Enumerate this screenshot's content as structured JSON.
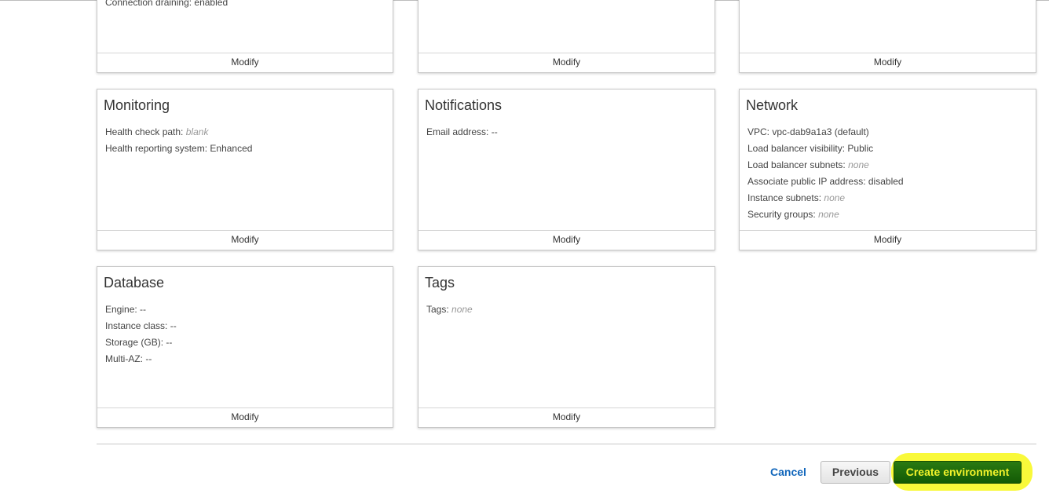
{
  "top_cards": [
    {
      "partial_text": "Connection draining: enabled",
      "footer": "Modify"
    },
    {
      "partial_text": "",
      "footer": "Modify"
    },
    {
      "partial_text": "",
      "footer": "Modify"
    }
  ],
  "cards": {
    "monitoring": {
      "title": "Monitoring",
      "rows": [
        {
          "label": "Health check path:",
          "value": "blank",
          "value_style": "none"
        },
        {
          "label": "Health reporting system:",
          "value": "Enhanced",
          "value_style": "normal"
        }
      ],
      "footer": "Modify"
    },
    "notifications": {
      "title": "Notifications",
      "rows": [
        {
          "label": "Email address:",
          "value": "--",
          "value_style": "normal"
        }
      ],
      "footer": "Modify"
    },
    "network": {
      "title": "Network",
      "rows": [
        {
          "label": "VPC:",
          "value": "vpc-dab9a1a3 (default)",
          "value_style": "normal"
        },
        {
          "label": "Load balancer visibility:",
          "value": "Public",
          "value_style": "normal"
        },
        {
          "label": "Load balancer subnets:",
          "value": "none",
          "value_style": "none"
        },
        {
          "label": "Associate public IP address:",
          "value": "disabled",
          "value_style": "normal"
        },
        {
          "label": "Instance subnets:",
          "value": "none",
          "value_style": "none"
        },
        {
          "label": "Security groups:",
          "value": "none",
          "value_style": "none"
        }
      ],
      "footer": "Modify"
    },
    "database": {
      "title": "Database",
      "rows": [
        {
          "label": "Engine:",
          "value": "--",
          "value_style": "normal"
        },
        {
          "label": "Instance class:",
          "value": "--",
          "value_style": "normal"
        },
        {
          "label": "Storage (GB):",
          "value": "--",
          "value_style": "normal"
        },
        {
          "label": "Multi-AZ:",
          "value": "--",
          "value_style": "normal"
        }
      ],
      "footer": "Modify"
    },
    "tags": {
      "title": "Tags",
      "rows": [
        {
          "label": "Tags:",
          "value": "none",
          "value_style": "none"
        }
      ],
      "footer": "Modify"
    }
  },
  "actions": {
    "cancel_label": "Cancel",
    "previous_label": "Previous",
    "create_label": "Create environment"
  },
  "colors": {
    "primary_button": "#135a05",
    "primary_button_text": "#f2f22a",
    "highlight": "#f9f93a",
    "link": "#1166bb"
  }
}
